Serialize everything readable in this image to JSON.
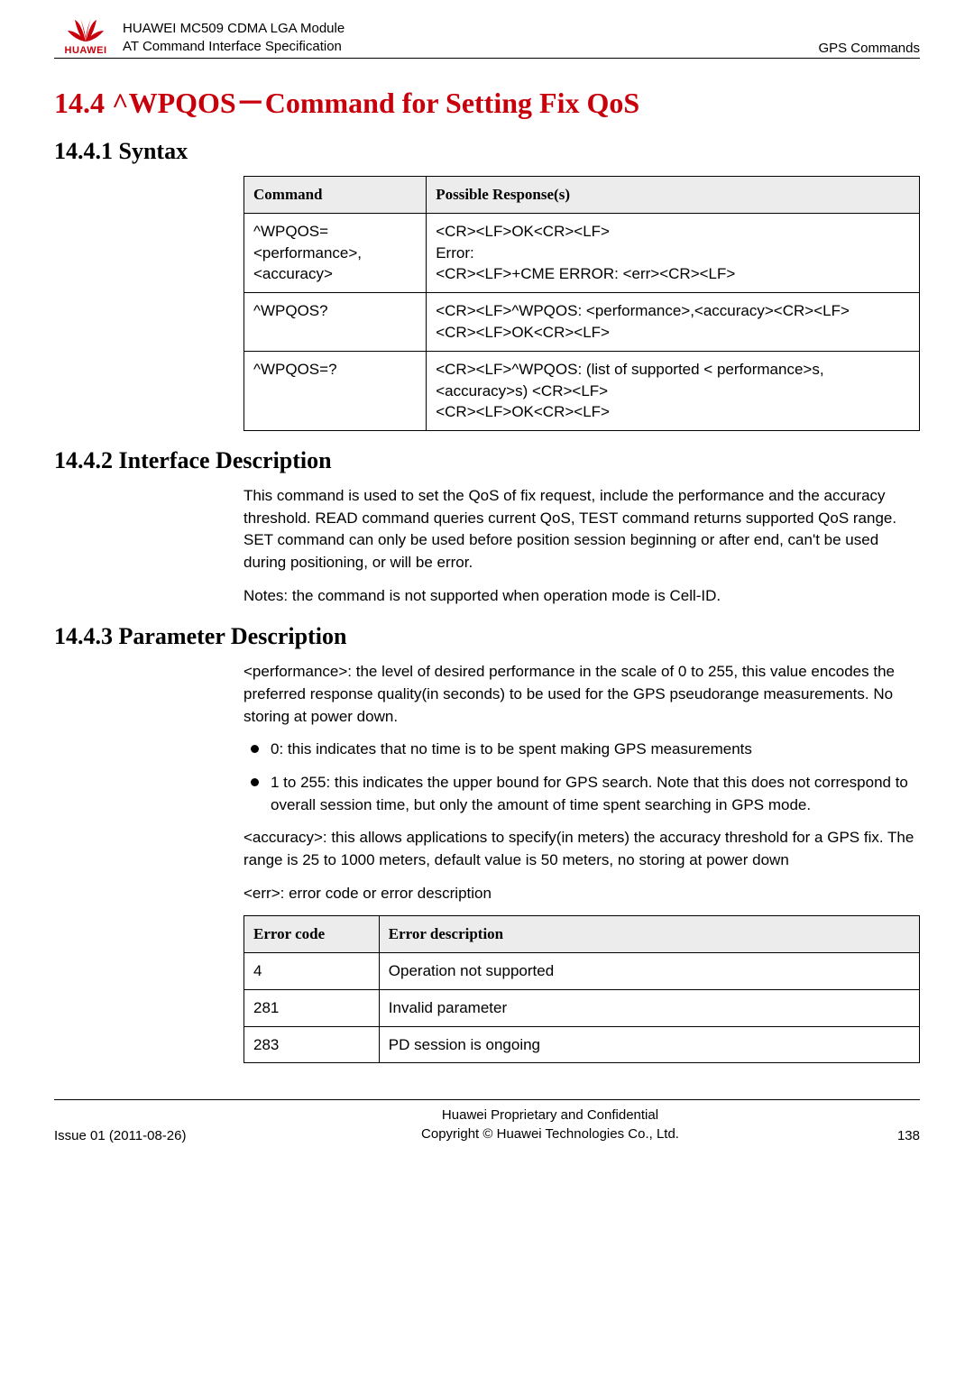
{
  "header": {
    "logo_text": "HUAWEI",
    "line1": "HUAWEI MC509 CDMA LGA Module",
    "line2": "AT Command Interface Specification",
    "right": "GPS Commands"
  },
  "section_title": "14.4 ^WPQOS－Command for Setting Fix QoS",
  "syntax": {
    "heading": "14.4.1 Syntax",
    "th_cmd": "Command",
    "th_resp": "Possible Response(s)",
    "rows": [
      {
        "cmd": "^WPQOS=<performance>,\n<accuracy>",
        "resp": "<CR><LF>OK<CR><LF>\nError:\n<CR><LF>+CME ERROR: <err><CR><LF>"
      },
      {
        "cmd": "^WPQOS?",
        "resp": "<CR><LF>^WPQOS: <performance>,<accuracy><CR><LF>\n<CR><LF>OK<CR><LF>"
      },
      {
        "cmd": "^WPQOS=?",
        "resp": "<CR><LF>^WPQOS: (list of supported < performance>s,<accuracy>s) <CR><LF>\n<CR><LF>OK<CR><LF>"
      }
    ]
  },
  "interface": {
    "heading": "14.4.2 Interface Description",
    "p1": "This command is used to set the QoS of fix request, include the performance and the accuracy threshold. READ command queries current QoS, TEST command returns supported QoS range. SET command can only be used before position session beginning or after end, can't be used during positioning, or will be error.",
    "p2": "Notes: the command is not supported when operation mode is Cell-ID."
  },
  "param": {
    "heading": "14.4.3 Parameter Description",
    "p1": "<performance>: the level of desired performance in the scale of 0 to 255, this value encodes the preferred response quality(in seconds) to be used for the GPS pseudorange measurements. No storing at power down.",
    "b1": "0: this indicates that no time is to be spent making GPS measurements",
    "b2": "1 to 255: this indicates the upper bound for GPS search. Note that this does not correspond to overall session time, but only the amount of time spent searching in GPS mode.",
    "p2": "<accuracy>: this allows applications to specify(in meters) the accuracy threshold for a GPS fix. The range is 25 to 1000 meters, default value is 50 meters, no storing at power down",
    "p3": "<err>: error code or error description",
    "err_th1": "Error code",
    "err_th2": "Error description",
    "err_rows": [
      {
        "code": "4",
        "desc": "Operation not supported"
      },
      {
        "code": "281",
        "desc": "Invalid parameter"
      },
      {
        "code": "283",
        "desc": "PD session is ongoing"
      }
    ]
  },
  "footer": {
    "left": "Issue 01 (2011-08-26)",
    "center1": "Huawei Proprietary and Confidential",
    "center2": "Copyright © Huawei Technologies Co., Ltd.",
    "right": "138"
  }
}
